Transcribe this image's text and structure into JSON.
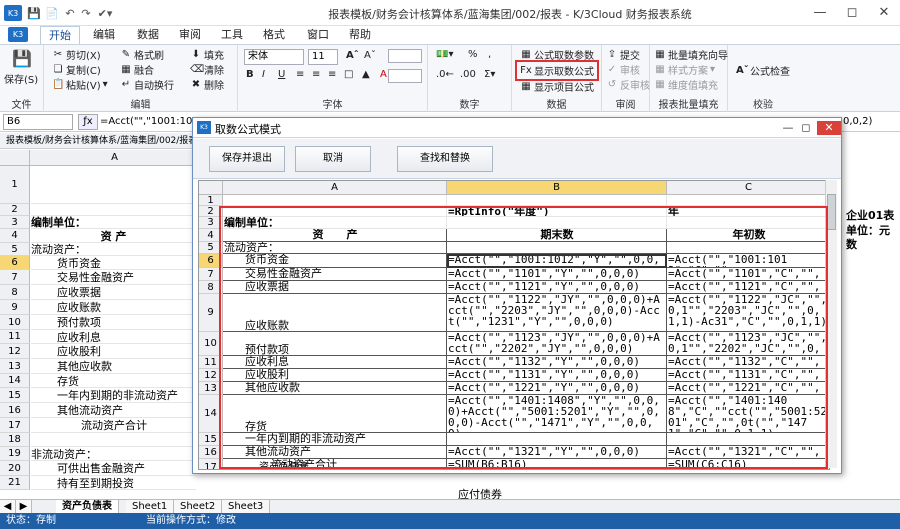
{
  "title": "报表模板/财务会计核算体系/蓝海集团/002/报表 - K/3Cloud 财务报表系统",
  "logo_text": "K3",
  "menu_tabs": [
    "开始",
    "编辑",
    "数据",
    "审阅",
    "工具",
    "格式",
    "窗口",
    "帮助"
  ],
  "active_tab_index": 0,
  "ribbon": {
    "file": {
      "save_label": "保存(S)",
      "group": "文件"
    },
    "edit": {
      "cut": "剪切(X)",
      "copy": "复制(C)",
      "paste": "粘贴(V)",
      "format_brush": "格式刷",
      "merge": "融合",
      "wrap": "自动换行",
      "fill": "填充",
      "clear": "清除",
      "delete": "删除",
      "group": "编辑"
    },
    "font": {
      "font_name": "宋体",
      "font_size": "11",
      "group": "字体"
    },
    "number": {
      "group": "数字"
    },
    "data": {
      "param": "公式取数参数",
      "show_formula": "显示取数公式",
      "show_item": "显示项目公式",
      "group": "数据"
    },
    "review": {
      "submit": "提交",
      "audit": "审核",
      "unaudit": "反审核",
      "group": "审阅"
    },
    "batch": {
      "batch_fill": "批量填充向导",
      "style": "样式方案",
      "dimension": "维度值填充",
      "group": "报表批量填充"
    },
    "check": {
      "formula_check": "公式检查",
      "group": "校验"
    }
  },
  "formula_bar": {
    "cell_ref": "B6",
    "formula": "=Acct(\"\",\"1001:1012\",",
    "right_fragment": "0,0,2)"
  },
  "doc_tab": "报表模板/财务会计核算体系/蓝海集团/002/报表",
  "background_sheet": {
    "col_a": "A",
    "rows": [
      {
        "n": "1",
        "text": "",
        "h": 38
      },
      {
        "n": "2",
        "text": "",
        "h": 12
      },
      {
        "n": "3",
        "text": "编制单位：",
        "h": 13,
        "bold": true
      },
      {
        "n": "4",
        "text": "资      产",
        "h": 14,
        "bold": true,
        "center": true
      },
      {
        "n": "5",
        "text": "流动资产：",
        "h": 13
      },
      {
        "n": "6",
        "text": "货币资金",
        "h": 14,
        "indent": 26
      },
      {
        "n": "7",
        "text": "交易性金融资产",
        "h": 15,
        "indent": 26
      },
      {
        "n": "8",
        "text": "应收票据",
        "h": 15,
        "indent": 26
      },
      {
        "n": "9",
        "text": "应收账款",
        "h": 15,
        "indent": 26
      },
      {
        "n": "10",
        "text": "预付款项",
        "h": 15,
        "indent": 26
      },
      {
        "n": "11",
        "text": "应收利息",
        "h": 14,
        "indent": 26
      },
      {
        "n": "12",
        "text": "应收股利",
        "h": 15,
        "indent": 26
      },
      {
        "n": "13",
        "text": "其他应收款",
        "h": 15,
        "indent": 26
      },
      {
        "n": "14",
        "text": "存货",
        "h": 14,
        "indent": 26
      },
      {
        "n": "15",
        "text": "一年内到期的非流动资产",
        "h": 15,
        "indent": 26
      },
      {
        "n": "16",
        "text": "其他流动资产",
        "h": 15,
        "indent": 26
      },
      {
        "n": "17",
        "text": "流动资产合计",
        "h": 15,
        "indent": 50
      },
      {
        "n": "18",
        "text": "",
        "h": 14
      },
      {
        "n": "19",
        "text": "非流动资产：",
        "h": 14
      },
      {
        "n": "20",
        "text": "可供出售金融资产",
        "h": 15,
        "indent": 26
      },
      {
        "n": "21",
        "text": "持有至到期投资",
        "h": 14,
        "indent": 26
      }
    ],
    "right_texts": [
      "企业01表",
      "单位：元",
      "数"
    ],
    "bottom_text": "应付债券"
  },
  "sheet_tabs": [
    "资产负债表",
    "Sheet1",
    "Sheet2",
    "Sheet3"
  ],
  "status": {
    "left": "状态：存制",
    "mid": "当前操作方式：修改"
  },
  "dialog": {
    "title": "取数公式模式",
    "buttons": {
      "save_exit": "保存并退出",
      "cancel": "取消",
      "find_replace": "查找和替换"
    },
    "columns": [
      "A",
      "B",
      "C"
    ],
    "sheet_tab": "资产负债表",
    "rows": [
      {
        "n": "1",
        "h": 11,
        "a": "",
        "b": "",
        "c": ""
      },
      {
        "n": "2",
        "h": 11,
        "a": "",
        "b": "=RptInfo(\"年度\")",
        "c": "年"
      },
      {
        "n": "3",
        "h": 12,
        "a": "编制单位：",
        "b": "",
        "c": ""
      },
      {
        "n": "4",
        "h": 13,
        "a": "资      产",
        "b": "期末数",
        "c": "年初数"
      },
      {
        "n": "5",
        "h": 12,
        "a": "流动资产：",
        "b": "",
        "c": ""
      },
      {
        "n": "6",
        "h": 14,
        "a": "货币资金",
        "b": "=Acct(\"\",\"1001:1012\",\"Y\",\"\",0,0,0)",
        "c": "=Acct(\"\",\"1001:1012\",\"C\",\"\""
      },
      {
        "n": "7",
        "h": 13,
        "a": "交易性金融资产",
        "b": "=Acct(\"\",\"1101\",\"Y\",\"\",0,0,0)",
        "c": "=Acct(\"\",\"1101\",\"C\",\"\",0,1,"
      },
      {
        "n": "8",
        "h": 13,
        "a": "应收票据",
        "b": "=Acct(\"\",\"1121\",\"Y\",\"\",0,0,0)",
        "c": "=Acct(\"\",\"1121\",\"C\",\"\",0,1,"
      },
      {
        "n": "9",
        "h": 38,
        "a": "应收账款",
        "b": "=Acct(\"\",\"1122\",\"JY\",\"\",0,0,0)+Acct(\"\",\"2203\",\"JY\",\"\",0,0,0)-Acct(\"\",\"1231\",\"Y\",\"\",0,0,0)",
        "c": "=Acct(\"\",\"1122\",\"JC\",\"\",0,1\"\",\"2203\",\"JC\",\"\",0,1,1)-Ac31\",\"C\",\"\",0,1,1)"
      },
      {
        "n": "10",
        "h": 24,
        "a": "预付款项",
        "b": "=Acct(\"\",\"1123\",\"JY\",\"\",0,0,0)+Acct(\"\",\"2202\",\"JY\",\"\",0,0,0)",
        "c": "=Acct(\"\",\"1123\",\"JC\",\"\",0,1\"\",\"2202\",\"JC\",\"\",0,1,1)"
      },
      {
        "n": "11",
        "h": 13,
        "a": "应收利息",
        "b": "=Acct(\"\",\"1132\",\"Y\",\"\",0,0,0)",
        "c": "=Acct(\"\",\"1132\",\"C\",\"\",0,1,"
      },
      {
        "n": "12",
        "h": 13,
        "a": "应收股利",
        "b": "=Acct(\"\",\"1131\",\"Y\",\"\",0,0,0)",
        "c": "=Acct(\"\",\"1131\",\"C\",\"\",0,1,"
      },
      {
        "n": "13",
        "h": 13,
        "a": "其他应收款",
        "b": "=Acct(\"\",\"1221\",\"Y\",\"\",0,0,0)",
        "c": "=Acct(\"\",\"1221\",\"C\",\"\",0,1,"
      },
      {
        "n": "14",
        "h": 38,
        "a": "存货",
        "b": "=Acct(\"\",\"1401:1408\",\"Y\",\"\",0,0,0)+Acct(\"\",\"5001:5201\",\"Y\",\"\",0,0,0)-Acct(\"\",\"1471\",\"Y\",\"\",0,0,0)",
        "c": "=Acct(\"\",\"1401:1408\",\"C\",\"\"cct(\"\",\"5001:5201\",\"C\",\"\",0t(\"\",\"1471\",\"C\",\"\",0,1,1)"
      },
      {
        "n": "15",
        "h": 13,
        "a": "一年内到期的非流动资产",
        "b": "",
        "c": ""
      },
      {
        "n": "16",
        "h": 13,
        "a": "其他流动资产",
        "b": "=Acct(\"\",\"1321\",\"Y\",\"\",0,0,0)",
        "c": "=Acct(\"\",\"1321\",\"C\",\"\",0,1,"
      },
      {
        "n": "17",
        "h": 18,
        "a": "流动资产合计",
        "b": "=SUM(B6:B16)",
        "c": "=SUM(C6:C16)"
      }
    ]
  },
  "colors": {
    "accent": "#1f5fa8",
    "highlight": "#e03030",
    "selected": "#f7d774"
  }
}
